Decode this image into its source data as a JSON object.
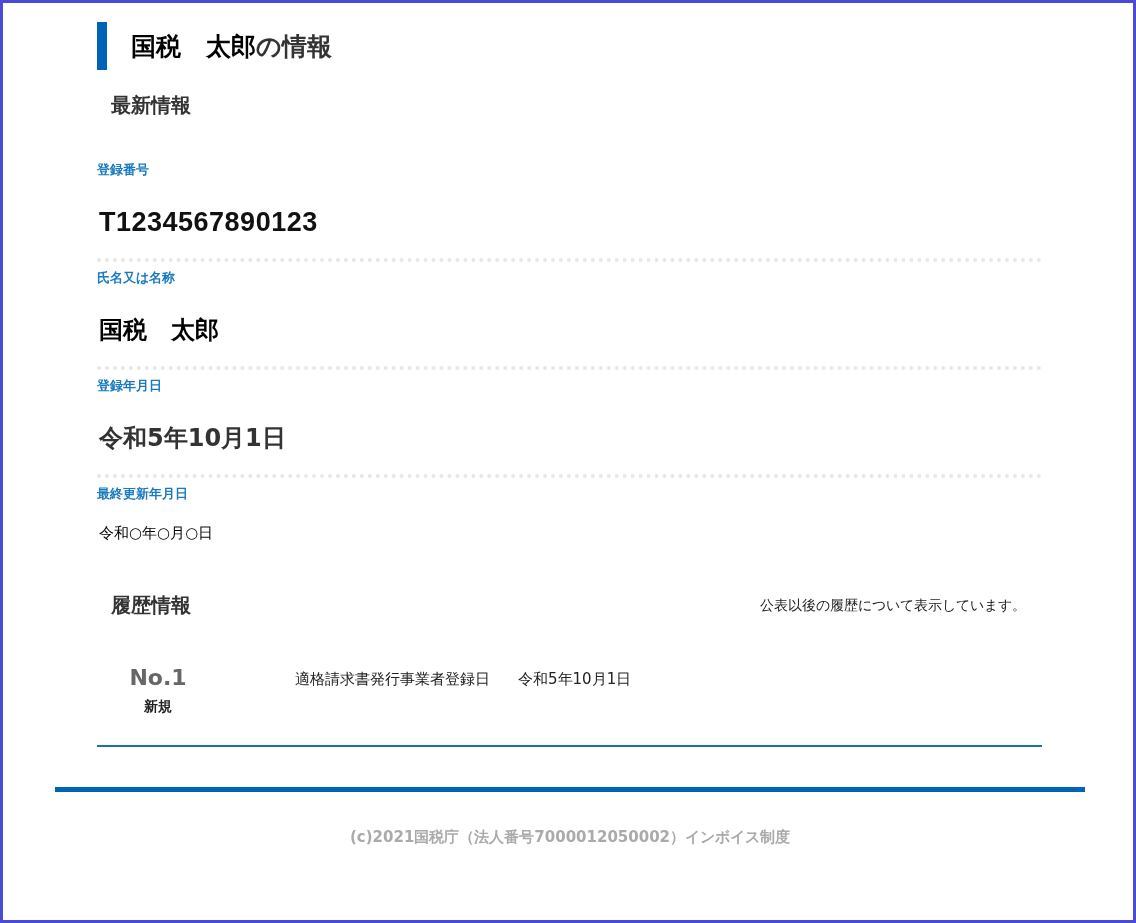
{
  "title": {
    "name": "国税　太郎",
    "suffix": "の情報"
  },
  "latest": {
    "heading": "最新情報",
    "fields": [
      {
        "label": "登録番号",
        "value": "T1234567890123",
        "kind": "code"
      },
      {
        "label": "氏名又は名称",
        "value": "国税　太郎",
        "kind": "name"
      },
      {
        "label": "登録年月日",
        "value": "令和5年10月1日",
        "kind": "date"
      },
      {
        "label": "最終更新年月日",
        "value": "令和○年○月○日",
        "kind": "plain"
      }
    ]
  },
  "history": {
    "heading": "履歴情報",
    "note": "公表以後の履歴について表示しています。",
    "entries": [
      {
        "number": "No.1",
        "type": "新規",
        "description": "適格請求書発行事業者登録日",
        "date": "令和5年10月1日"
      }
    ]
  },
  "footer": {
    "copyright": "(c)2021国税庁（法人番号7000012050002）インボイス制度"
  }
}
